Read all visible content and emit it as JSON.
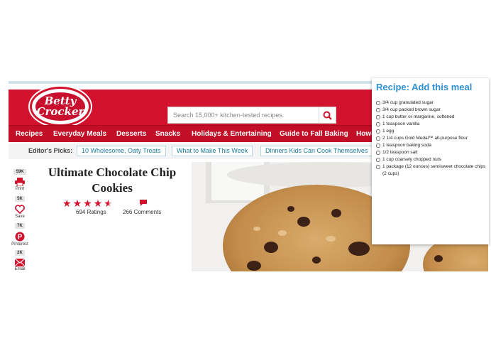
{
  "search": {
    "placeholder": "Search 15,000+ kitchen-tested recipes."
  },
  "logo": {
    "line1": "Betty",
    "line2": "Crocker"
  },
  "nav": {
    "items": [
      "Recipes",
      "Everyday Meals",
      "Desserts",
      "Snacks",
      "Holidays & Entertaining",
      "Guide to Fall Baking",
      "How-"
    ]
  },
  "picks": {
    "label": "Editor's Picks:",
    "items": [
      "10 Wholesome, Oaty Treats",
      "What to Make This Week",
      "Dinners Kids Can Cook Themselves"
    ]
  },
  "share": [
    {
      "count": "59K",
      "label": "Print",
      "icon": "printer-icon"
    },
    {
      "count": "5K",
      "label": "Save",
      "icon": "heart-icon"
    },
    {
      "count": "7K",
      "label": "Pinterest",
      "icon": "pinterest-icon"
    },
    {
      "count": "2K",
      "label": "Email",
      "icon": "email-icon"
    }
  ],
  "recipe": {
    "title": "Ultimate Chocolate Chip Cookies",
    "rating": 4.5,
    "ratings_text": "694 Ratings",
    "comments_text": "266 Comments"
  },
  "panel": {
    "title": "Recipe: Add this meal",
    "ingredients": [
      "3/4 cup granulated sugar",
      "3/4 cup packed brown sugar",
      "1 cup butter or margarine, softened",
      "1 teaspoon vanilla",
      "1 egg",
      "2 1/4 cups Gold Medal™ all-purpose flour",
      "1 teaspoon baking soda",
      "1/2 teaspoon salt",
      "1 cup coarsely chopped nuts",
      "1 package (12 ounces) semisweet chocolate chips (2 cups)"
    ]
  },
  "colors": {
    "brand_red": "#d2112c",
    "panel_title_blue": "#2f8fd0",
    "pick_link": "#1b7d9d"
  }
}
